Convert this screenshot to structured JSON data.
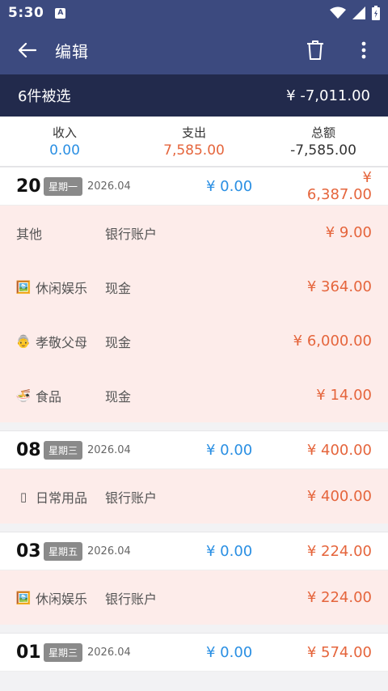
{
  "status_bar": {
    "time": "5:30",
    "notification_letter": "A"
  },
  "app_bar": {
    "title": "编辑"
  },
  "selection": {
    "count_label": "6件被选",
    "total": "¥ -7,011.00"
  },
  "summary": {
    "income_label": "收入",
    "income_value": "0.00",
    "expense_label": "支出",
    "expense_value": "7,585.00",
    "total_label": "总额",
    "total_value": "-7,585.00"
  },
  "groups": [
    {
      "day": "20",
      "weekday": "星期一",
      "month": "2026.04",
      "income": "¥ 0.00",
      "expense": "¥ 6,387.00",
      "rows": [
        {
          "icon": "",
          "category": "其他",
          "account": "银行账户",
          "amount": "¥ 9.00"
        },
        {
          "icon": "🖼️",
          "category": "休闲娱乐",
          "account": "现金",
          "amount": "¥ 364.00"
        },
        {
          "icon": "👵",
          "category": "孝敬父母",
          "account": "现金",
          "amount": "¥ 6,000.00"
        },
        {
          "icon": "🍜",
          "category": "食品",
          "account": "现金",
          "amount": "¥ 14.00"
        }
      ]
    },
    {
      "day": "08",
      "weekday": "星期三",
      "month": "2026.04",
      "income": "¥ 0.00",
      "expense": "¥ 400.00",
      "rows": [
        {
          "icon": "▯",
          "category": "日常用品",
          "account": "银行账户",
          "amount": "¥ 400.00"
        }
      ]
    },
    {
      "day": "03",
      "weekday": "星期五",
      "month": "2026.04",
      "income": "¥ 0.00",
      "expense": "¥ 224.00",
      "rows": [
        {
          "icon": "🖼️",
          "category": "休闲娱乐",
          "account": "银行账户",
          "amount": "¥ 224.00"
        }
      ]
    },
    {
      "day": "01",
      "weekday": "星期三",
      "month": "2026.04",
      "income": "¥ 0.00",
      "expense": "¥ 574.00",
      "rows": []
    }
  ]
}
